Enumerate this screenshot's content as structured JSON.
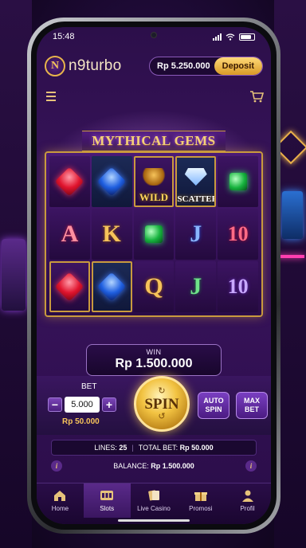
{
  "status_bar": {
    "time": "15:48"
  },
  "header": {
    "logo_letter": "N",
    "brand": "n9turbo",
    "balance": "Rp 5.250.000",
    "deposit_label": "Deposit"
  },
  "game": {
    "title": "MYTHICAL GEMS",
    "reels": [
      [
        "red-gem",
        "blue-gem",
        "wild",
        "scatter-diamond",
        "green-gem"
      ],
      [
        "A",
        "K",
        "green-gem",
        "J",
        "10"
      ],
      [
        "red-gem",
        "blue-gem",
        "Q",
        "J",
        "10"
      ]
    ],
    "wild_label": "WILD",
    "scatter_label": "SCATTER",
    "symbols": {
      "a": "A",
      "k": "K",
      "q": "Q",
      "j": "J",
      "ten": "10"
    }
  },
  "win": {
    "label": "WIN",
    "amount": "Rp 1.500.000"
  },
  "bet": {
    "label": "BET",
    "minus": "−",
    "value": "5.000",
    "plus": "+",
    "total": "Rp 50.000"
  },
  "spin": {
    "label": "SPIN"
  },
  "auto_spin": {
    "line1": "AUTO",
    "line2": "SPIN"
  },
  "max_bet": {
    "line1": "MAX",
    "line2": "BET"
  },
  "lines": {
    "lines_label": "LINES:",
    "lines_value": "25",
    "separator": "|",
    "total_bet_label": "TOTAL BET:",
    "total_bet_value": "Rp 50.000"
  },
  "info": {
    "icon": "i",
    "balance_label": "BALANCE:",
    "balance_value": "Rp 1.500.000"
  },
  "nav": {
    "items": [
      {
        "label": "Home",
        "icon": "home-icon"
      },
      {
        "label": "Slots",
        "icon": "slots-icon",
        "active": true
      },
      {
        "label": "Live Casino",
        "icon": "cards-icon"
      },
      {
        "label": "Promosi",
        "icon": "gift-icon"
      },
      {
        "label": "Profil",
        "icon": "user-icon"
      }
    ]
  },
  "colors": {
    "accent_gold": "#f6c35a",
    "primary_purple": "#3a145e",
    "deposit_gold": "#ffd978"
  }
}
